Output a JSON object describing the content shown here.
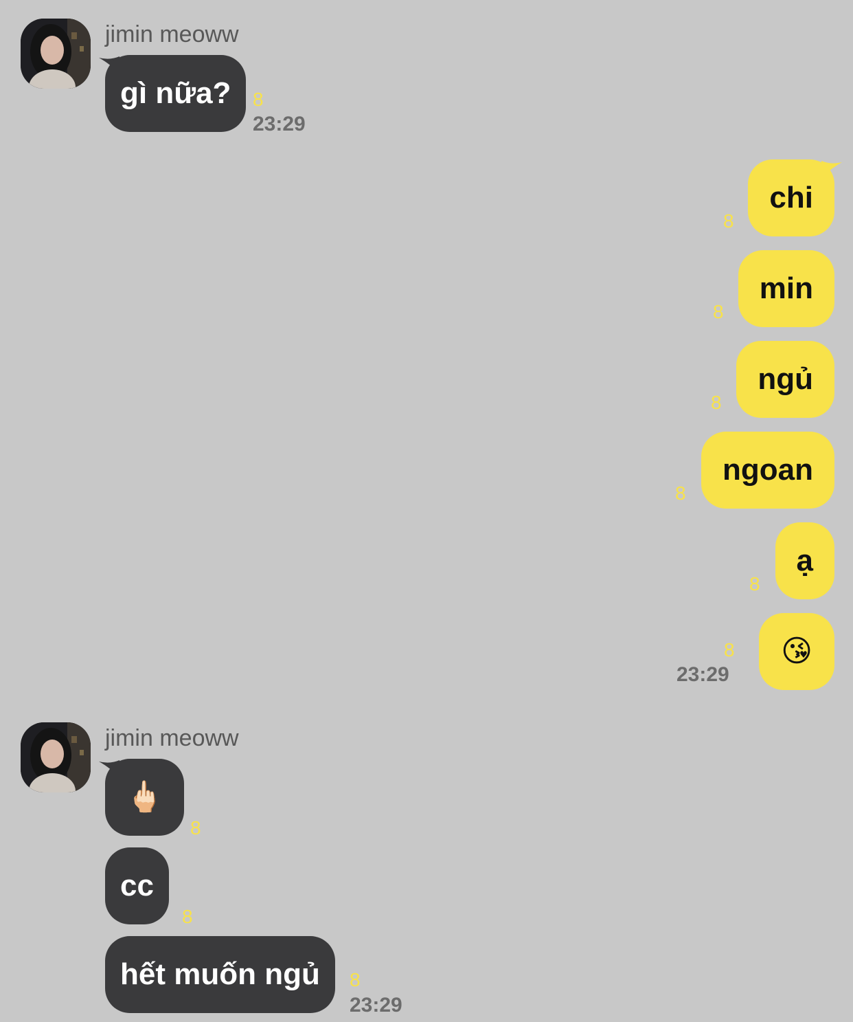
{
  "groups": [
    {
      "sender": "jimin meoww",
      "messages": [
        {
          "text": "gì nữa?",
          "unread": "8",
          "time": "23:29"
        }
      ]
    },
    {
      "sender": "",
      "messages": [
        {
          "text": "chi",
          "unread": "8"
        },
        {
          "text": "min",
          "unread": "8"
        },
        {
          "text": "ngủ",
          "unread": "8"
        },
        {
          "text": "ngoan",
          "unread": "8"
        },
        {
          "text": "ạ",
          "unread": "8"
        },
        {
          "text": "😘",
          "unread": "8",
          "time": "23:29"
        }
      ]
    },
    {
      "sender": "jimin meoww",
      "messages": [
        {
          "text": "🖕🏻",
          "unread": "8"
        },
        {
          "text": "cc",
          "unread": "8"
        },
        {
          "text": "hết muốn ngủ",
          "unread": "8",
          "time": "23:29"
        }
      ]
    }
  ],
  "colors": {
    "background": "#c8c8c8",
    "incoming_bubble": "#3a3a3c",
    "outgoing_bubble": "#f8e24a",
    "unread_count": "#f8e24a",
    "timestamp": "#6c6c6c"
  }
}
